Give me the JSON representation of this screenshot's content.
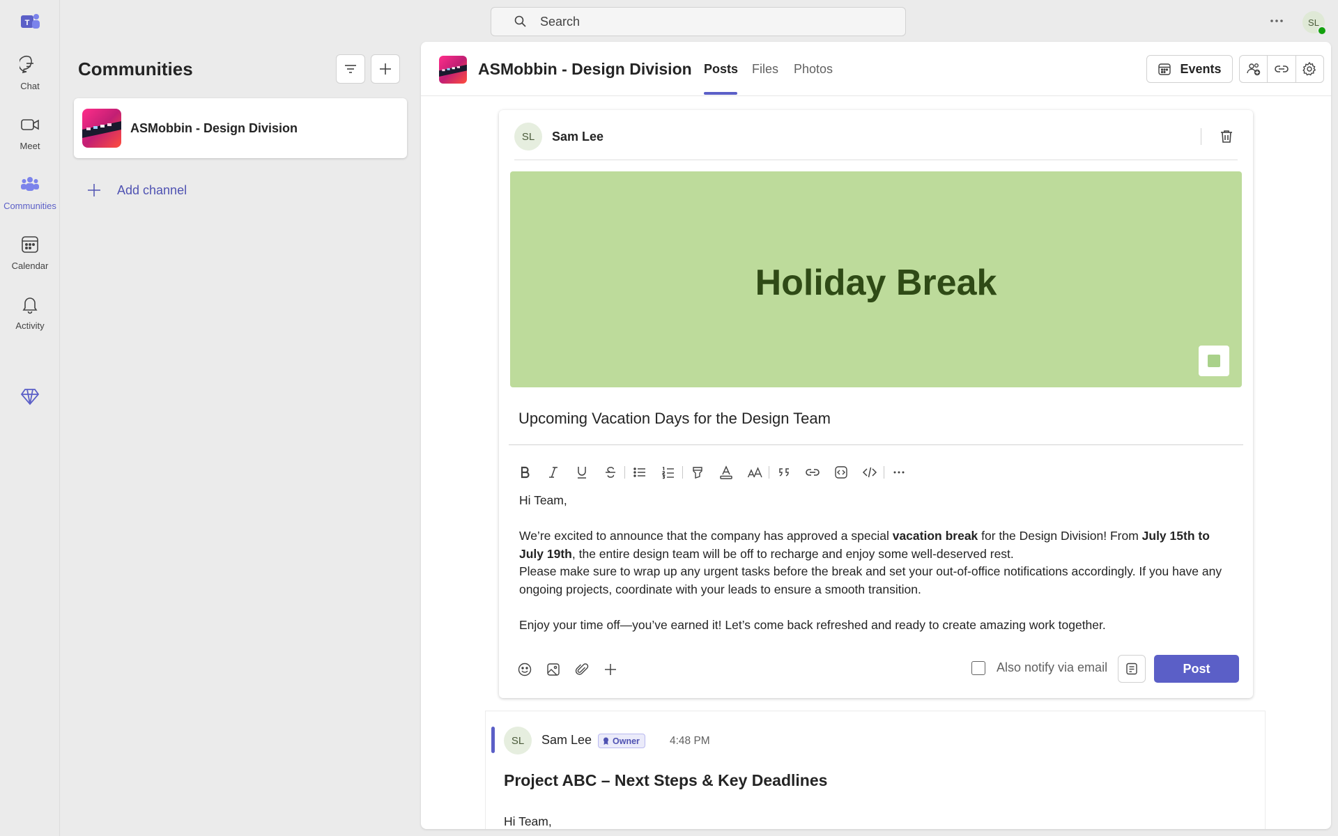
{
  "rail": {
    "items": [
      {
        "label": "Chat"
      },
      {
        "label": "Meet"
      },
      {
        "label": "Communities"
      },
      {
        "label": "Calendar"
      },
      {
        "label": "Activity"
      }
    ],
    "active": "Communities"
  },
  "topbar": {
    "search_placeholder": "Search",
    "avatar_initials": "SL"
  },
  "panel": {
    "title": "Communities",
    "channel_name": "ASMobbin - Design Division",
    "add_channel_label": "Add channel"
  },
  "header": {
    "title": "ASMobbin - Design Division",
    "tabs": [
      {
        "label": "Posts",
        "active": true
      },
      {
        "label": "Files",
        "active": false
      },
      {
        "label": "Photos",
        "active": false
      }
    ],
    "events_label": "Events"
  },
  "compose": {
    "author_initials": "SL",
    "author_name": "Sam Lee",
    "banner_text": "Holiday Break",
    "subject": "Upcoming Vacation Days for the Design Team",
    "body": {
      "greeting": "Hi Team,",
      "p1_a": "We’re excited to announce that the company has approved a special ",
      "p1_bold1": "vacation break",
      "p1_b": " for the Design Division! From ",
      "p1_bold2": "July 15th to July 19th",
      "p1_c": ", the entire design team will be off to recharge and enjoy some well-deserved rest.",
      "p2": "Please make sure to wrap up any urgent tasks before the break and set your out-of-office notifications accordingly. If you have any ongoing projects, coordinate with your leads to ensure a smooth transition.",
      "p3": "Enjoy your time off—you’ve earned it! Let’s come back refreshed and ready to create amazing work together."
    },
    "notify_label": "Also notify via email",
    "post_label": "Post"
  },
  "post": {
    "author_initials": "SL",
    "author_name": "Sam Lee",
    "badge": "Owner",
    "time": "4:48 PM",
    "title": "Project ABC – Next Steps & Key Deadlines",
    "body_preview": "Hi Team,"
  },
  "colors": {
    "accent": "#5b5fc7",
    "banner_bg": "#bddb9b",
    "banner_text": "#2f4a16",
    "presence": "#13a10e"
  }
}
